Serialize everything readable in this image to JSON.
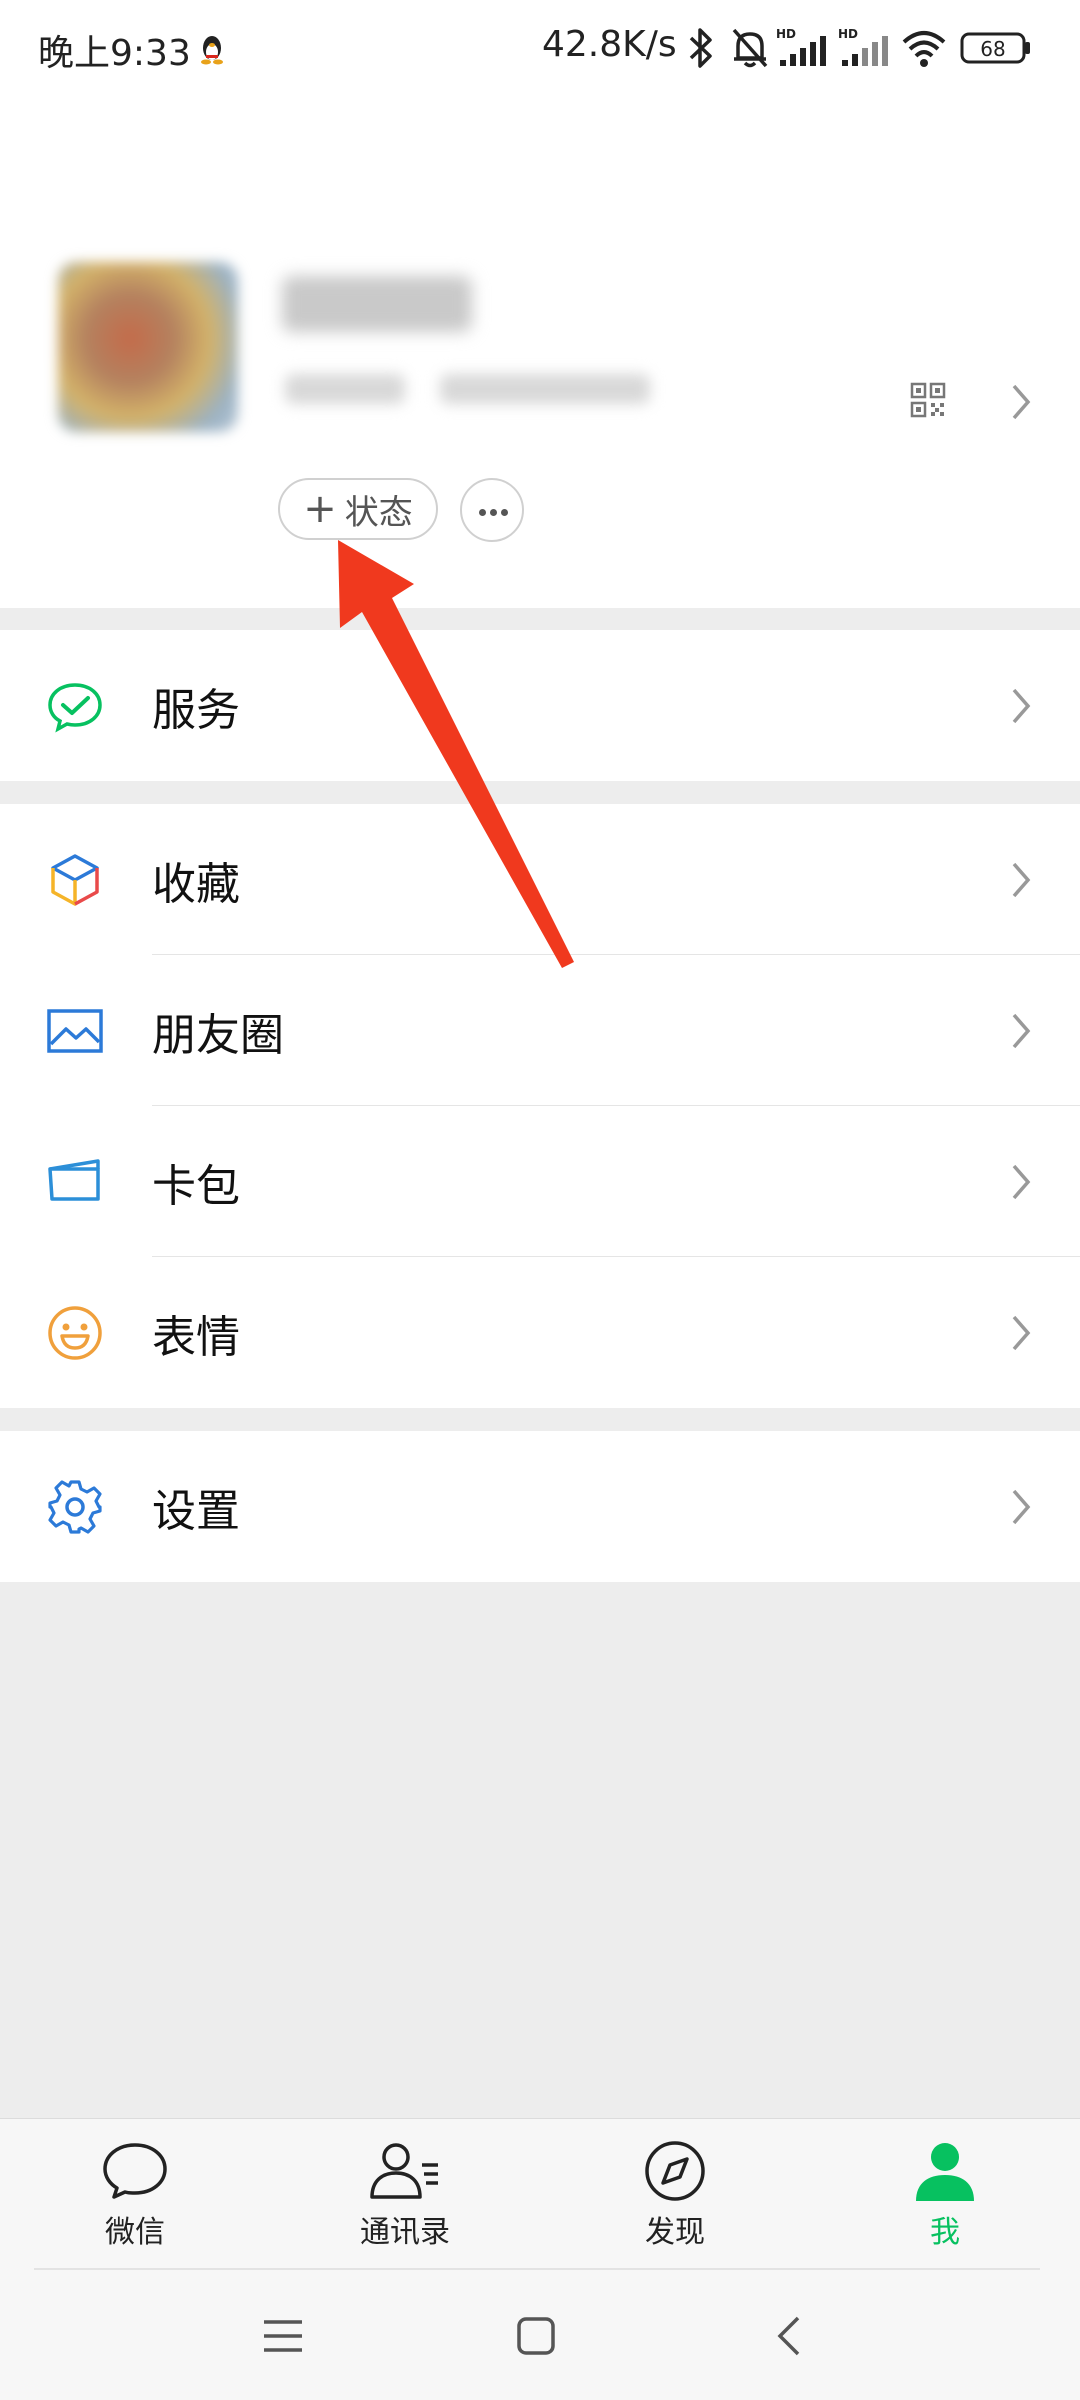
{
  "status_bar": {
    "time": "晚上9:33",
    "network_speed": "42.8K/s",
    "battery": "68"
  },
  "profile": {
    "status_button_label": "状态",
    "status_button_plus": "+"
  },
  "menu": {
    "services": "服务",
    "favorites": "收藏",
    "moments": "朋友圈",
    "cards": "卡包",
    "stickers": "表情",
    "settings": "设置"
  },
  "tabs": [
    {
      "label": "微信",
      "icon": "chat-bubble-icon"
    },
    {
      "label": "通讯录",
      "icon": "contacts-icon"
    },
    {
      "label": "发现",
      "icon": "compass-icon"
    },
    {
      "label": "我",
      "icon": "person-icon"
    }
  ],
  "colors": {
    "accent": "#07c160",
    "annotation_arrow": "#f0391e",
    "page_bg": "#ededed"
  }
}
